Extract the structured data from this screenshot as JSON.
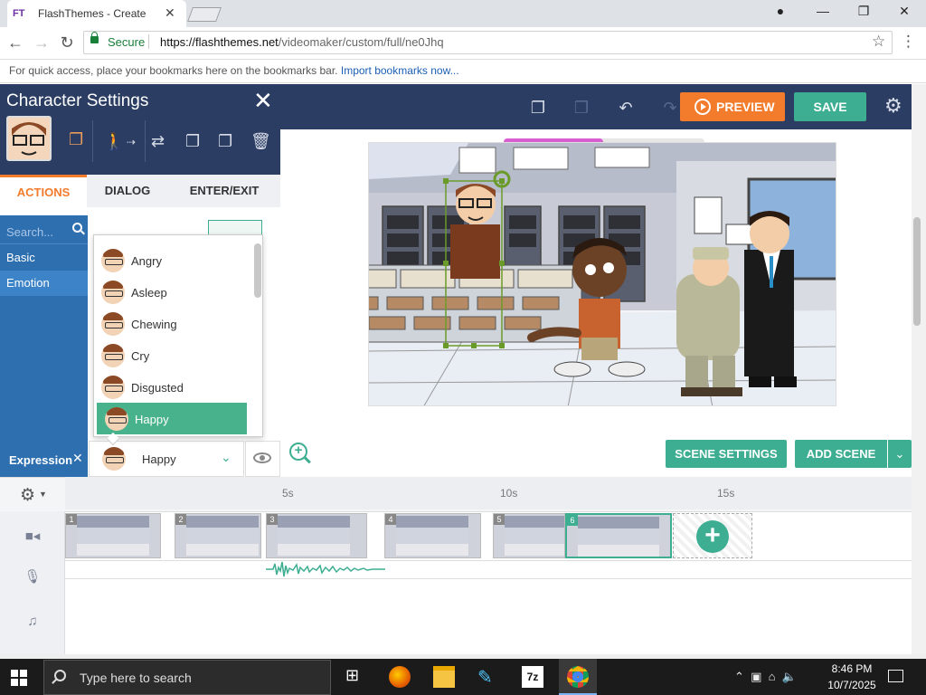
{
  "browser": {
    "tab_title": "FlashThemes - Create",
    "favicon_text": "FT",
    "secure_label": "Secure",
    "url_host": "https://flashthemes.net",
    "url_path": "/videomaker/custom/full/ne0Jhq",
    "bookmarks_hint": "For quick access, place your bookmarks here on the bookmarks bar.",
    "bookmarks_link": "Import bookmarks now..."
  },
  "toolbar": {
    "preview_label": "PREVIEW",
    "save_label": "SAVE"
  },
  "panel": {
    "title": "Character Settings",
    "tabs": [
      "ACTIONS",
      "DIALOG",
      "ENTER/EXIT"
    ],
    "search_placeholder": "Search...",
    "categories": [
      "Basic",
      "Emotion"
    ],
    "expression_label": "Expression",
    "expression_value": "Happy",
    "options": [
      "Angry",
      "Asleep",
      "Chewing",
      "Cry",
      "Disgusted",
      "Happy"
    ]
  },
  "stage": {
    "scene_settings_label": "SCENE SETTINGS",
    "add_scene_label": "ADD SCENE"
  },
  "timeline": {
    "ticks": [
      "5s",
      "10s",
      "15s"
    ],
    "scenes": [
      "1",
      "2",
      "3",
      "4",
      "5",
      "6"
    ],
    "selected_scene": "6"
  },
  "taskbar": {
    "search_placeholder": "Type here to search",
    "time": "8:46 PM",
    "date": "10/7/2025"
  },
  "colors": {
    "accent_green": "#3dae91",
    "preview_orange": "#f27b2c",
    "panel_navy": "#2b3d63",
    "category_blue": "#2e6fb0"
  }
}
